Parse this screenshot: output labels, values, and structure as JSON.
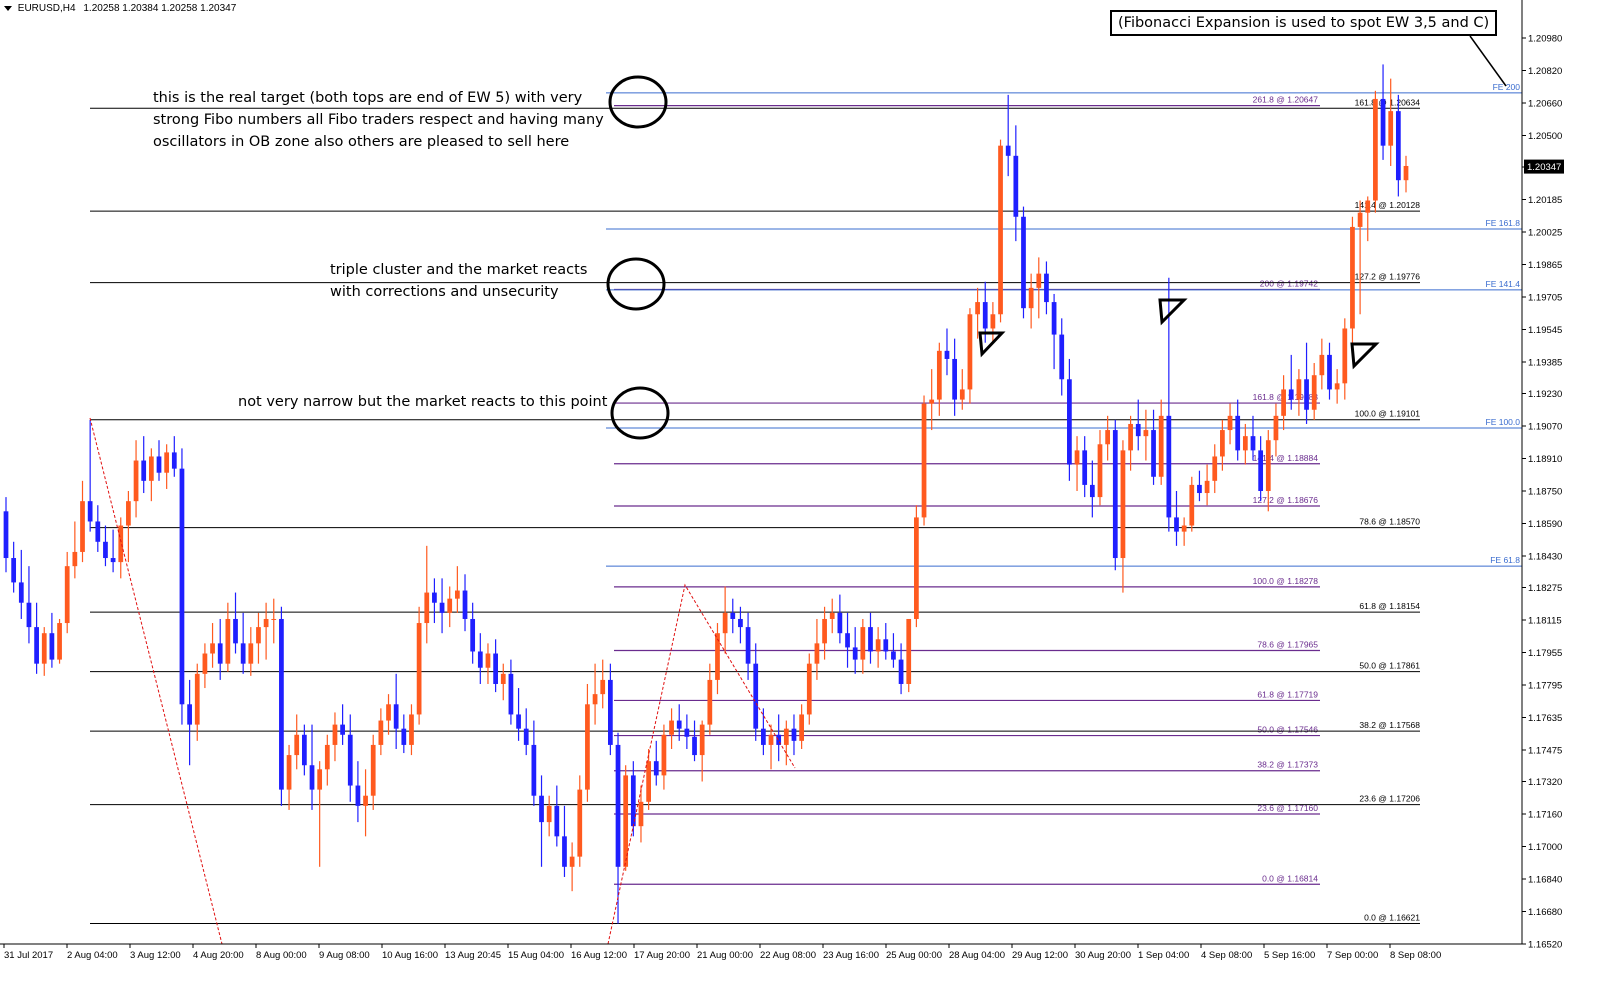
{
  "header": {
    "symbol": "EURUSD,H4",
    "ohlc": "1.20258 1.20384 1.20258 1.20347",
    "dropdown_icon": "triangle-down-icon"
  },
  "annotations": {
    "callout": "(Fibonacci Expansion is used to spot EW 3,5 and C)",
    "note_top_1": "this is the real target (both tops are end of EW 5) with very",
    "note_top_2": "strong Fibo numbers all Fibo traders respect and having many",
    "note_top_3": "oscillators in OB zone also others are pleased to sell here",
    "note_mid_1": "triple cluster and the market reacts",
    "note_mid_2": "with corrections and unsecurity",
    "note_low_1": "not very narrow but the market reacts  to this point"
  },
  "colors": {
    "bull": "#ff5a1f",
    "bear": "#1f1fff",
    "fe_line": "#3a6ccf",
    "fib_purple": "#6a2c8e",
    "fib_black": "#000000",
    "zigzag": "#e01010"
  },
  "chart_data": {
    "type": "candlestick",
    "price_axis": {
      "min": 1.1652,
      "max": 1.2098,
      "ticks": [
        "1.20980",
        "1.20820",
        "1.20660",
        "1.20500",
        "1.20345",
        "1.20185",
        "1.20025",
        "1.19865",
        "1.19705",
        "1.19545",
        "1.19385",
        "1.19230",
        "1.19070",
        "1.18910",
        "1.18750",
        "1.18590",
        "1.18430",
        "1.18275",
        "1.18115",
        "1.17955",
        "1.17795",
        "1.17635",
        "1.17475",
        "1.17320",
        "1.17160",
        "1.17000",
        "1.16840",
        "1.16680",
        "1.16520"
      ],
      "current_price": "1.20347"
    },
    "time_axis": [
      "31 Jul 2017",
      "2 Aug 04:00",
      "3 Aug 12:00",
      "4 Aug 20:00",
      "8 Aug 00:00",
      "9 Aug 08:00",
      "10 Aug 16:00",
      "13 Aug 20:45",
      "15 Aug 04:00",
      "16 Aug 12:00",
      "17 Aug 20:00",
      "21 Aug 00:00",
      "22 Aug 08:00",
      "23 Aug 16:00",
      "25 Aug 00:00",
      "28 Aug 04:00",
      "29 Aug 12:00",
      "30 Aug 20:00",
      "1 Sep 04:00",
      "4 Sep 08:00",
      "5 Sep 16:00",
      "7 Sep 00:00",
      "8 Sep 08:00"
    ],
    "candles": [
      [
        1.1865,
        1.1872,
        1.1835,
        1.1842
      ],
      [
        1.1842,
        1.185,
        1.1825,
        1.183
      ],
      [
        1.183,
        1.1846,
        1.1812,
        1.182
      ],
      [
        1.182,
        1.1838,
        1.18,
        1.1808
      ],
      [
        1.1808,
        1.182,
        1.1785,
        1.179
      ],
      [
        1.179,
        1.1808,
        1.1784,
        1.1805
      ],
      [
        1.1805,
        1.1815,
        1.1788,
        1.1792
      ],
      [
        1.1792,
        1.1812,
        1.179,
        1.181
      ],
      [
        1.181,
        1.1845,
        1.1805,
        1.1838
      ],
      [
        1.1838,
        1.186,
        1.1832,
        1.1845
      ],
      [
        1.1845,
        1.188,
        1.184,
        1.187
      ],
      [
        1.187,
        1.191,
        1.1855,
        1.186
      ],
      [
        1.186,
        1.1868,
        1.1845,
        1.185
      ],
      [
        1.185,
        1.1858,
        1.1838,
        1.1842
      ],
      [
        1.1842,
        1.1856,
        1.1835,
        1.184
      ],
      [
        1.184,
        1.1862,
        1.1832,
        1.1858
      ],
      [
        1.1858,
        1.1875,
        1.184,
        1.187
      ],
      [
        1.187,
        1.19,
        1.1862,
        1.189
      ],
      [
        1.189,
        1.1902,
        1.1874,
        1.188
      ],
      [
        1.188,
        1.1896,
        1.187,
        1.1892
      ],
      [
        1.1892,
        1.19,
        1.188,
        1.1884
      ],
      [
        1.1884,
        1.1898,
        1.1876,
        1.1894
      ],
      [
        1.1894,
        1.1902,
        1.1882,
        1.1886
      ],
      [
        1.1886,
        1.1896,
        1.176,
        1.177
      ],
      [
        1.177,
        1.1782,
        1.174,
        1.176
      ],
      [
        1.176,
        1.179,
        1.1752,
        1.1785
      ],
      [
        1.1785,
        1.18,
        1.1778,
        1.1795
      ],
      [
        1.1795,
        1.181,
        1.1788,
        1.18
      ],
      [
        1.18,
        1.1812,
        1.1782,
        1.179
      ],
      [
        1.179,
        1.182,
        1.1786,
        1.1812
      ],
      [
        1.1812,
        1.1825,
        1.1795,
        1.18
      ],
      [
        1.18,
        1.1815,
        1.1785,
        1.179
      ],
      [
        1.179,
        1.1808,
        1.1784,
        1.18
      ],
      [
        1.18,
        1.1815,
        1.179,
        1.1808
      ],
      [
        1.1808,
        1.182,
        1.1792,
        1.1812
      ],
      [
        1.1812,
        1.1822,
        1.18,
        1.1812
      ],
      [
        1.1812,
        1.1818,
        1.172,
        1.1728
      ],
      [
        1.1728,
        1.175,
        1.1718,
        1.1745
      ],
      [
        1.1745,
        1.1765,
        1.1738,
        1.1755
      ],
      [
        1.1755,
        1.176,
        1.1735,
        1.174
      ],
      [
        1.174,
        1.176,
        1.1718,
        1.1728
      ],
      [
        1.1728,
        1.1742,
        1.169,
        1.1738
      ],
      [
        1.1738,
        1.1755,
        1.173,
        1.175
      ],
      [
        1.175,
        1.1766,
        1.1742,
        1.176
      ],
      [
        1.176,
        1.177,
        1.175,
        1.1755
      ],
      [
        1.1755,
        1.1765,
        1.1722,
        1.173
      ],
      [
        1.173,
        1.1742,
        1.1712,
        1.172
      ],
      [
        1.172,
        1.1738,
        1.1705,
        1.1725
      ],
      [
        1.1725,
        1.1755,
        1.1718,
        1.175
      ],
      [
        1.175,
        1.1768,
        1.1745,
        1.1762
      ],
      [
        1.1762,
        1.1775,
        1.1755,
        1.177
      ],
      [
        1.177,
        1.1785,
        1.1748,
        1.1758
      ],
      [
        1.1758,
        1.1765,
        1.1746,
        1.175
      ],
      [
        1.175,
        1.177,
        1.1745,
        1.1765
      ],
      [
        1.1765,
        1.1818,
        1.176,
        1.181
      ],
      [
        1.181,
        1.1848,
        1.18,
        1.1825
      ],
      [
        1.1825,
        1.1832,
        1.181,
        1.182
      ],
      [
        1.182,
        1.1832,
        1.1805,
        1.1815
      ],
      [
        1.1815,
        1.1828,
        1.1808,
        1.1822
      ],
      [
        1.1822,
        1.1838,
        1.1815,
        1.1826
      ],
      [
        1.1826,
        1.1834,
        1.1806,
        1.1812
      ],
      [
        1.1812,
        1.182,
        1.179,
        1.1796
      ],
      [
        1.1796,
        1.1805,
        1.178,
        1.1788
      ],
      [
        1.1788,
        1.18,
        1.178,
        1.1795
      ],
      [
        1.1795,
        1.1802,
        1.1776,
        1.178
      ],
      [
        1.178,
        1.179,
        1.1772,
        1.1785
      ],
      [
        1.1785,
        1.1792,
        1.176,
        1.1765
      ],
      [
        1.1765,
        1.1778,
        1.1752,
        1.1758
      ],
      [
        1.1758,
        1.1768,
        1.1745,
        1.175
      ],
      [
        1.175,
        1.1762,
        1.172,
        1.1725
      ],
      [
        1.1725,
        1.1735,
        1.169,
        1.1712
      ],
      [
        1.1712,
        1.1725,
        1.1705,
        1.172
      ],
      [
        1.172,
        1.173,
        1.17,
        1.1705
      ],
      [
        1.1705,
        1.172,
        1.1685,
        1.169
      ],
      [
        1.169,
        1.1702,
        1.1678,
        1.1695
      ],
      [
        1.1695,
        1.1735,
        1.169,
        1.1728
      ],
      [
        1.1728,
        1.178,
        1.1722,
        1.177
      ],
      [
        1.177,
        1.179,
        1.176,
        1.1775
      ],
      [
        1.1775,
        1.1792,
        1.1768,
        1.1782
      ],
      [
        1.1782,
        1.179,
        1.1745,
        1.175
      ],
      [
        1.175,
        1.1756,
        1.1662,
        1.169
      ],
      [
        1.169,
        1.174,
        1.1688,
        1.1735
      ],
      [
        1.1735,
        1.1742,
        1.1705,
        1.171
      ],
      [
        1.171,
        1.173,
        1.1702,
        1.1722
      ],
      [
        1.1722,
        1.1748,
        1.1718,
        1.1742
      ],
      [
        1.1742,
        1.1752,
        1.173,
        1.1735
      ],
      [
        1.1735,
        1.176,
        1.1728,
        1.1755
      ],
      [
        1.1755,
        1.1768,
        1.1748,
        1.1762
      ],
      [
        1.1762,
        1.177,
        1.1752,
        1.1758
      ],
      [
        1.1758,
        1.1765,
        1.1748,
        1.1754
      ],
      [
        1.1754,
        1.1762,
        1.1742,
        1.1745
      ],
      [
        1.1745,
        1.1762,
        1.1732,
        1.176
      ],
      [
        1.176,
        1.179,
        1.1755,
        1.1782
      ],
      [
        1.1782,
        1.181,
        1.1775,
        1.1805
      ],
      [
        1.1805,
        1.1828,
        1.1795,
        1.1815
      ],
      [
        1.1815,
        1.1822,
        1.1805,
        1.1812
      ],
      [
        1.1812,
        1.1818,
        1.18,
        1.1808
      ],
      [
        1.1808,
        1.1815,
        1.1782,
        1.179
      ],
      [
        1.179,
        1.18,
        1.1752,
        1.1758
      ],
      [
        1.1758,
        1.1768,
        1.1745,
        1.175
      ],
      [
        1.175,
        1.176,
        1.1738,
        1.1755
      ],
      [
        1.1755,
        1.1765,
        1.1742,
        1.175
      ],
      [
        1.175,
        1.1762,
        1.174,
        1.1758
      ],
      [
        1.1758,
        1.1765,
        1.1745,
        1.1752
      ],
      [
        1.1752,
        1.177,
        1.1748,
        1.1765
      ],
      [
        1.1765,
        1.1795,
        1.176,
        1.179
      ],
      [
        1.179,
        1.1812,
        1.1782,
        1.18
      ],
      [
        1.18,
        1.1818,
        1.1792,
        1.1812
      ],
      [
        1.1812,
        1.1822,
        1.1805,
        1.1815
      ],
      [
        1.1815,
        1.1824,
        1.18,
        1.1805
      ],
      [
        1.1805,
        1.1815,
        1.1788,
        1.1798
      ],
      [
        1.1798,
        1.1808,
        1.1785,
        1.1792
      ],
      [
        1.1792,
        1.1812,
        1.1785,
        1.1808
      ],
      [
        1.1808,
        1.1815,
        1.179,
        1.1796
      ],
      [
        1.1796,
        1.1808,
        1.1788,
        1.1802
      ],
      [
        1.1802,
        1.181,
        1.1792,
        1.1796
      ],
      [
        1.1796,
        1.1805,
        1.1788,
        1.1792
      ],
      [
        1.1792,
        1.18,
        1.1775,
        1.178
      ],
      [
        1.178,
        1.181,
        1.1776,
        1.1812
      ],
      [
        1.1812,
        1.1868,
        1.1808,
        1.1862
      ],
      [
        1.1862,
        1.1922,
        1.1858,
        1.1918
      ],
      [
        1.1918,
        1.1935,
        1.1905,
        1.192
      ],
      [
        1.192,
        1.1948,
        1.1912,
        1.1944
      ],
      [
        1.1944,
        1.1955,
        1.1932,
        1.194
      ],
      [
        1.194,
        1.195,
        1.1912,
        1.192
      ],
      [
        1.192,
        1.1935,
        1.1915,
        1.1925
      ],
      [
        1.1925,
        1.1965,
        1.1918,
        1.1962
      ],
      [
        1.1962,
        1.1975,
        1.195,
        1.1968
      ],
      [
        1.1968,
        1.1978,
        1.1948,
        1.1955
      ],
      [
        1.1955,
        1.1968,
        1.1948,
        1.1962
      ],
      [
        1.1962,
        1.2048,
        1.1958,
        1.2045
      ],
      [
        1.2045,
        1.207,
        1.203,
        1.204
      ],
      [
        1.204,
        1.2055,
        1.1998,
        1.201
      ],
      [
        1.201,
        1.2015,
        1.196,
        1.1965
      ],
      [
        1.1965,
        1.1982,
        1.1955,
        1.1975
      ],
      [
        1.1975,
        1.199,
        1.196,
        1.1982
      ],
      [
        1.1982,
        1.1988,
        1.1962,
        1.1968
      ],
      [
        1.1968,
        1.1972,
        1.1935,
        1.1952
      ],
      [
        1.1952,
        1.196,
        1.1922,
        1.193
      ],
      [
        1.193,
        1.194,
        1.188,
        1.1888
      ],
      [
        1.1888,
        1.1902,
        1.1875,
        1.1895
      ],
      [
        1.1895,
        1.1902,
        1.1872,
        1.1878
      ],
      [
        1.1878,
        1.189,
        1.1862,
        1.1872
      ],
      [
        1.1872,
        1.1905,
        1.1868,
        1.1898
      ],
      [
        1.1898,
        1.1912,
        1.189,
        1.1905
      ],
      [
        1.1905,
        1.191,
        1.1836,
        1.1842
      ],
      [
        1.1842,
        1.19,
        1.1825,
        1.1895
      ],
      [
        1.1895,
        1.1912,
        1.1885,
        1.1908
      ],
      [
        1.1908,
        1.192,
        1.1895,
        1.1902
      ],
      [
        1.1902,
        1.1915,
        1.189,
        1.1905
      ],
      [
        1.1905,
        1.1915,
        1.1878,
        1.1882
      ],
      [
        1.1882,
        1.192,
        1.1878,
        1.1912
      ],
      [
        1.1912,
        1.198,
        1.1855,
        1.1862
      ],
      [
        1.1862,
        1.1875,
        1.1848,
        1.1855
      ],
      [
        1.1855,
        1.1862,
        1.1848,
        1.1858
      ],
      [
        1.1858,
        1.1882,
        1.1855,
        1.1878
      ],
      [
        1.1878,
        1.1885,
        1.187,
        1.1874
      ],
      [
        1.1874,
        1.1888,
        1.1868,
        1.188
      ],
      [
        1.188,
        1.1898,
        1.1874,
        1.1892
      ],
      [
        1.1892,
        1.191,
        1.1885,
        1.1905
      ],
      [
        1.1905,
        1.1918,
        1.1898,
        1.1912
      ],
      [
        1.1912,
        1.192,
        1.189,
        1.1895
      ],
      [
        1.1895,
        1.1908,
        1.1888,
        1.1902
      ],
      [
        1.1902,
        1.1912,
        1.189,
        1.1895
      ],
      [
        1.1895,
        1.1902,
        1.187,
        1.1875
      ],
      [
        1.1875,
        1.1905,
        1.1865,
        1.19
      ],
      [
        1.19,
        1.1918,
        1.1892,
        1.1912
      ],
      [
        1.1912,
        1.1932,
        1.1905,
        1.1925
      ],
      [
        1.1925,
        1.1942,
        1.1915,
        1.192
      ],
      [
        1.192,
        1.1935,
        1.1912,
        1.193
      ],
      [
        1.193,
        1.1948,
        1.1908,
        1.1915
      ],
      [
        1.1915,
        1.1938,
        1.191,
        1.1932
      ],
      [
        1.1932,
        1.195,
        1.1925,
        1.1942
      ],
      [
        1.1942,
        1.1948,
        1.192,
        1.1925
      ],
      [
        1.1925,
        1.1935,
        1.1918,
        1.1928
      ],
      [
        1.1928,
        1.196,
        1.192,
        1.1955
      ],
      [
        1.1955,
        1.201,
        1.1948,
        1.2005
      ],
      [
        1.2005,
        1.2018,
        1.1962,
        1.2012
      ],
      [
        1.2012,
        1.202,
        1.1998,
        1.2018
      ],
      [
        1.2018,
        1.2072,
        1.2012,
        1.2068
      ],
      [
        1.2068,
        1.2085,
        1.2038,
        1.2045
      ],
      [
        1.2045,
        1.2078,
        1.2035,
        1.2062
      ],
      [
        1.2062,
        1.207,
        1.202,
        1.2028
      ],
      [
        1.2028,
        1.204,
        1.2022,
        1.2035
      ]
    ],
    "fib_levels": [
      {
        "label": "261.8 @ 1.20647",
        "price": 1.20647,
        "group": "p1"
      },
      {
        "label": "200 @ 1.19742",
        "price": 1.19742,
        "group": "p1"
      },
      {
        "label": "161.8 @ 1.19183",
        "price": 1.19183,
        "group": "p1"
      },
      {
        "label": "141.4 @ 1.18884",
        "price": 1.18884,
        "group": "p1"
      },
      {
        "label": "127.2 @ 1.18676",
        "price": 1.18676,
        "group": "p1"
      },
      {
        "label": "100.0 @ 1.18278",
        "price": 1.18278,
        "group": "p1"
      },
      {
        "label": "78.6 @ 1.17965",
        "price": 1.17965,
        "group": "p1"
      },
      {
        "label": "61.8 @ 1.17719",
        "price": 1.17719,
        "group": "p1"
      },
      {
        "label": "50.0 @ 1.17546",
        "price": 1.17546,
        "group": "p1"
      },
      {
        "label": "38.2 @ 1.17373",
        "price": 1.17373,
        "group": "p1"
      },
      {
        "label": "23.6 @ 1.17160",
        "price": 1.1716,
        "group": "p1"
      },
      {
        "label": "0.0 @ 1.16814",
        "price": 1.16814,
        "group": "p1"
      },
      {
        "label": "161.8 @ 1.20634",
        "price": 1.20634,
        "group": "k1"
      },
      {
        "label": "141.4 @ 1.20128",
        "price": 1.20128,
        "group": "k1"
      },
      {
        "label": "127.2 @ 1.19776",
        "price": 1.19776,
        "group": "k1"
      },
      {
        "label": "100.0 @ 1.19101",
        "price": 1.19101,
        "group": "k1"
      },
      {
        "label": "78.6 @ 1.18570",
        "price": 1.1857,
        "group": "k1"
      },
      {
        "label": "61.8 @ 1.18154",
        "price": 1.18154,
        "group": "k1"
      },
      {
        "label": "50.0 @ 1.17861",
        "price": 1.17861,
        "group": "k1"
      },
      {
        "label": "38.2 @ 1.17568",
        "price": 1.17568,
        "group": "k1"
      },
      {
        "label": "23.6 @ 1.17206",
        "price": 1.17206,
        "group": "k1"
      },
      {
        "label": "0.0 @ 1.16621",
        "price": 1.16621,
        "group": "k1"
      },
      {
        "label": "FE 200",
        "price": 1.2071,
        "group": "fe"
      },
      {
        "label": "FE 161.8",
        "price": 1.2004,
        "group": "fe"
      },
      {
        "label": "FE 141.4",
        "price": 1.1974,
        "group": "fe"
      },
      {
        "label": "FE 100.0",
        "price": 1.1906,
        "group": "fe"
      },
      {
        "label": "FE 61.8",
        "price": 1.1838,
        "group": "fe"
      }
    ]
  }
}
